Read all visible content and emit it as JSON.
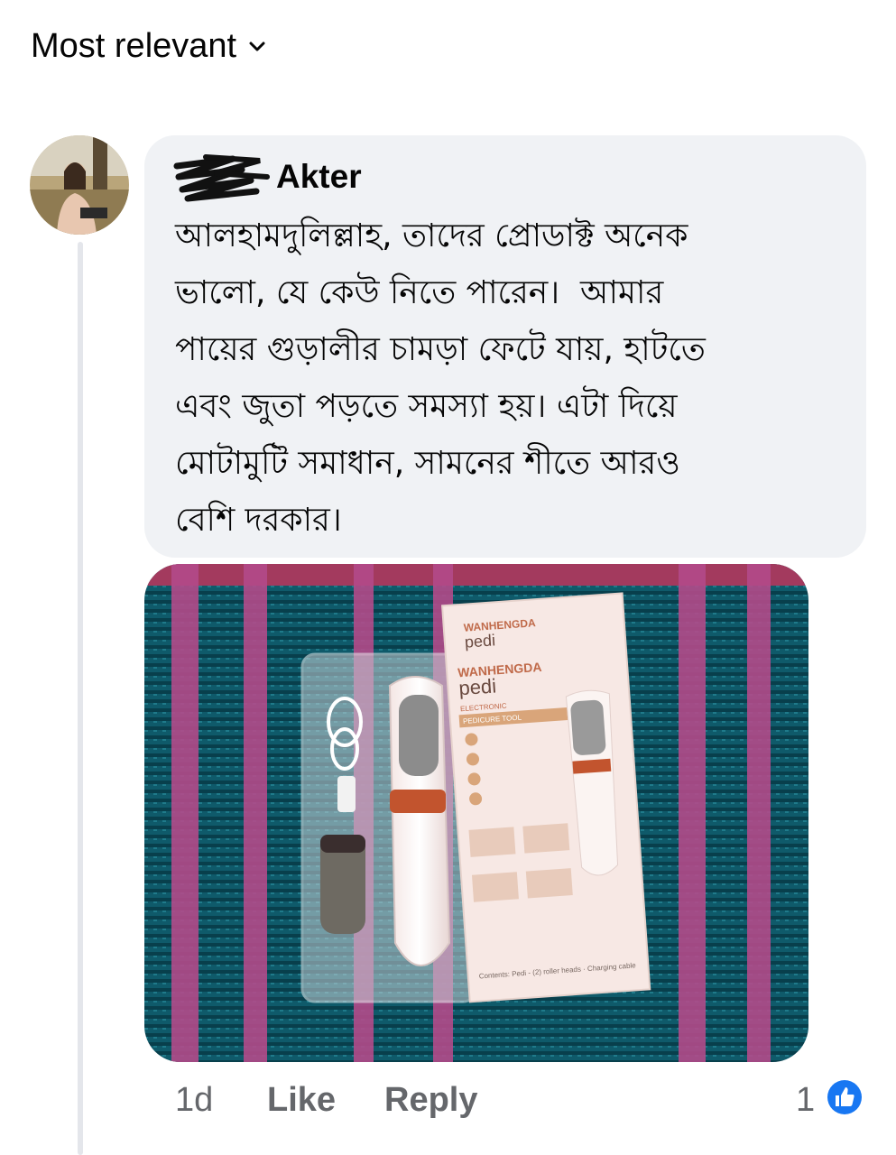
{
  "sort": {
    "label": "Most relevant",
    "icon": "chevron-down-icon"
  },
  "comment": {
    "author_visible": "Akter",
    "text": "আলহামদুলিল্লাহ, তাদের প্রোডাক্ট অনেক\nভালো, যে কেউ নিতে পারেন।  আমার\nপায়ের গুড়ালীর চামড়া ফেটে যায়, হাটতে\nএবং জুতা পড়তে সমস্যা হয়। এটা দিয়ে\nমোটামুটি সমাধান, সামনের শীতে আরও\nবেশি দরকার।",
    "photo": {
      "box_brand_top": "WANHENGDA",
      "box_sub_top": "pedi",
      "box_brand": "WANHENGDA",
      "box_sub": "pedi",
      "box_type": "ELECTRONIC",
      "box_tool": "PEDICURE TOOL",
      "box_contents": "Contents: Pedi - (2) roller heads · Charging cable"
    }
  },
  "actions": {
    "time": "1d",
    "like": "Like",
    "reply": "Reply",
    "reaction_count": "1"
  },
  "colors": {
    "bubble": "#f0f2f5",
    "meta": "#65676b",
    "like_blue": "#1877f2"
  }
}
